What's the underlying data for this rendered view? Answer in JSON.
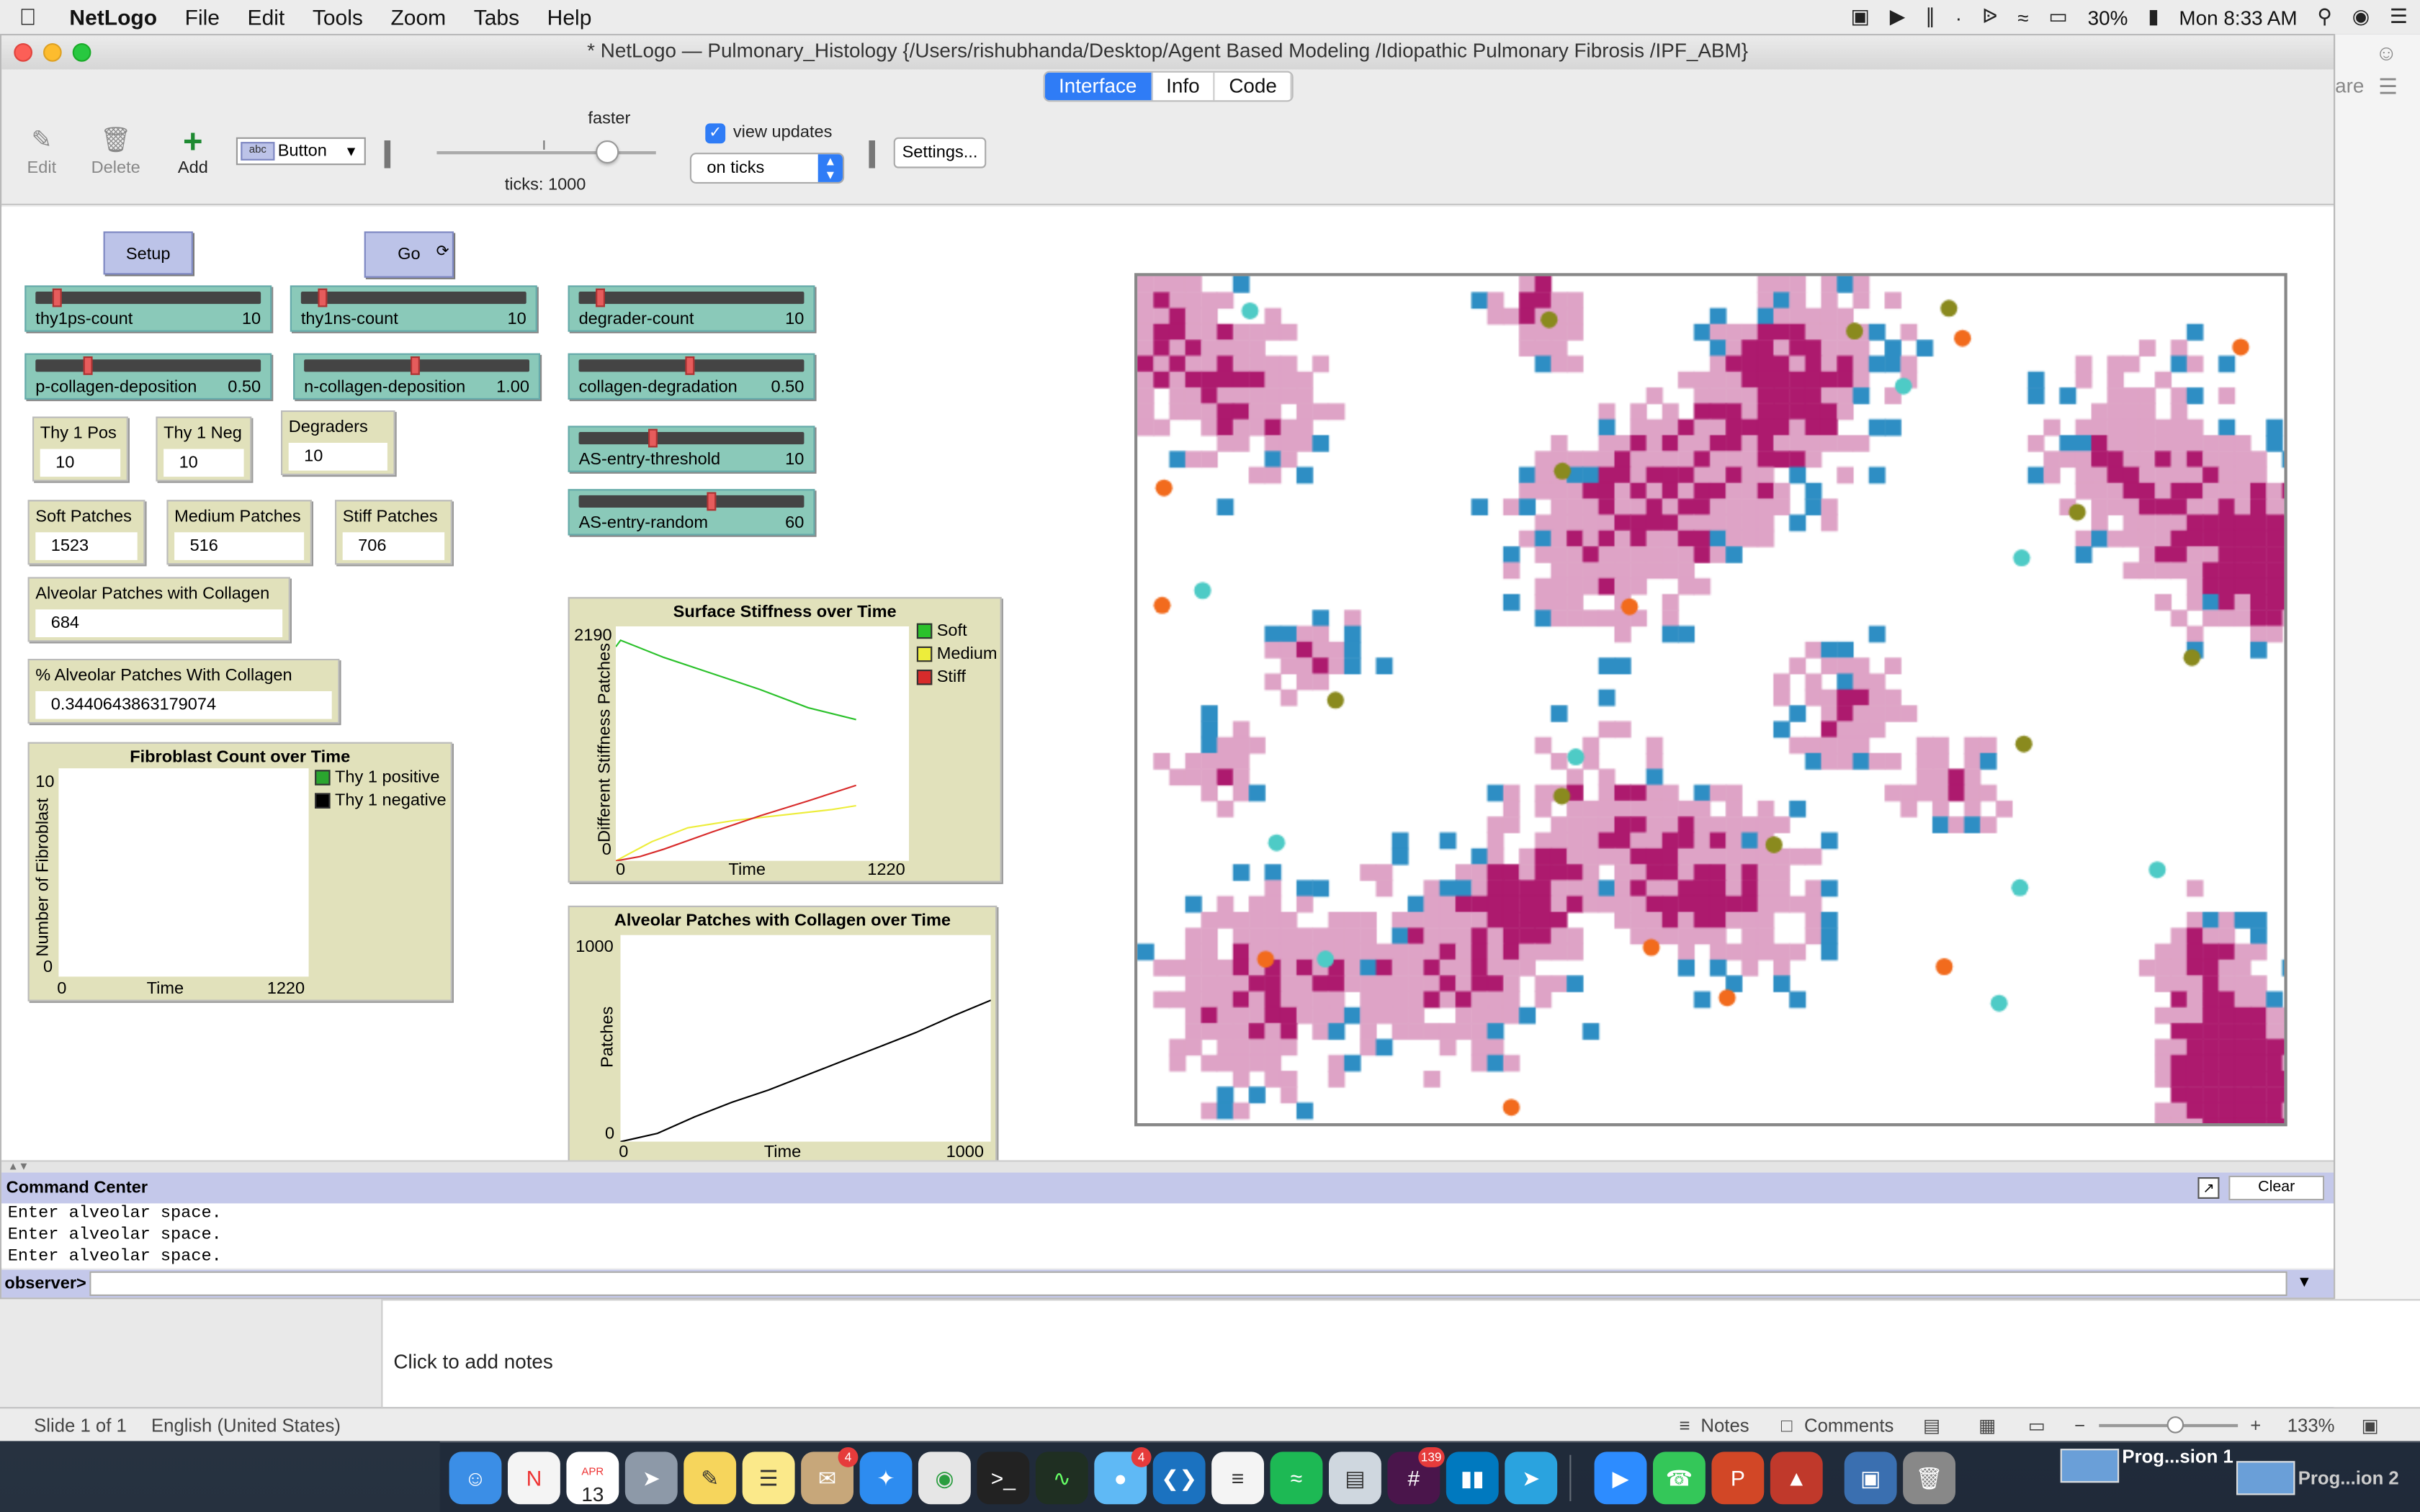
{
  "menubar": {
    "app": "NetLogo",
    "items": [
      "File",
      "Edit",
      "Tools",
      "Zoom",
      "Tabs",
      "Help"
    ],
    "battery": "30%",
    "clock": "Mon 8:33 AM"
  },
  "window": {
    "title": "* NetLogo — Pulmonary_Histology {/Users/rishubhanda/Desktop/Agent Based Modeling /Idiopathic Pulmonary Fibrosis /IPF_ABM}",
    "tabs": [
      "Interface",
      "Info",
      "Code"
    ],
    "active_tab": "Interface"
  },
  "toolbar": {
    "edit": "Edit",
    "delete": "Delete",
    "add": "Add",
    "widget_type": "Button",
    "speed_label": "faster",
    "ticks": "ticks: 1000",
    "view_updates": "view updates",
    "update_mode": "on ticks",
    "settings": "Settings..."
  },
  "buttons": {
    "setup": "Setup",
    "go": "Go"
  },
  "sliders": [
    {
      "label": "thy1ps-count",
      "value": "10",
      "pos": 0.1
    },
    {
      "label": "thy1ns-count",
      "value": "10",
      "pos": 0.1
    },
    {
      "label": "degrader-count",
      "value": "10",
      "pos": 0.1
    },
    {
      "label": "p-collagen-deposition",
      "value": "0.50",
      "pos": 0.2
    },
    {
      "label": "n-collagen-deposition",
      "value": "1.00",
      "pos": 0.5
    },
    {
      "label": "collagen-degradation",
      "value": "0.50",
      "pos": 0.5
    },
    {
      "label": "AS-entry-threshold",
      "value": "10",
      "pos": 0.33
    },
    {
      "label": "AS-entry-random",
      "value": "60",
      "pos": 0.6
    }
  ],
  "monitors": [
    {
      "label": "Thy 1 Pos",
      "value": "10"
    },
    {
      "label": "Thy 1 Neg",
      "value": "10"
    },
    {
      "label": "Degraders",
      "value": "10"
    },
    {
      "label": "Soft Patches",
      "value": "1523"
    },
    {
      "label": "Medium Patches",
      "value": "516"
    },
    {
      "label": "Stiff Patches",
      "value": "706"
    },
    {
      "label": "Alveolar Patches with Collagen",
      "value": "684"
    },
    {
      "label": "% Alveolar Patches With Collagen",
      "value": "0.3440643863179074"
    }
  ],
  "plots": {
    "fibroblast": {
      "title": "Fibroblast Count over Time",
      "ylabel": "Number of Fibroblast",
      "xlabel": "Time",
      "ymax": "10",
      "ymin": "0",
      "xmin": "0",
      "xmax": "1220",
      "legend": [
        {
          "name": "Thy 1 positive",
          "color": "#2aa52e"
        },
        {
          "name": "Thy 1 negative",
          "color": "#000000"
        }
      ]
    },
    "stiffness": {
      "title": "Surface Stiffness over Time",
      "ylabel": "Different Stiffness Patches",
      "xlabel": "Time",
      "ymax": "2190",
      "ymin": "0",
      "xmin": "0",
      "xmax": "1220",
      "legend": [
        {
          "name": "Soft",
          "color": "#2bc12b"
        },
        {
          "name": "Medium",
          "color": "#eded3b"
        },
        {
          "name": "Stiff",
          "color": "#d82b2b"
        }
      ]
    },
    "alveolar": {
      "title": "Alveolar Patches with Collagen over Time",
      "ylabel": "Patches",
      "xlabel": "Time",
      "ymax": "1000",
      "ymin": "0",
      "xmin": "0",
      "xmax": "1000"
    }
  },
  "chart_data": [
    {
      "type": "line",
      "title": "Fibroblast Count over Time",
      "xlabel": "Time",
      "ylabel": "Number of Fibroblast",
      "xlim": [
        0,
        1220
      ],
      "ylim": [
        0,
        10
      ],
      "series": [
        {
          "name": "Thy 1 positive",
          "x": [],
          "y": []
        },
        {
          "name": "Thy 1 negative",
          "x": [],
          "y": []
        }
      ]
    },
    {
      "type": "line",
      "title": "Surface Stiffness over Time",
      "xlabel": "Time",
      "ylabel": "Different Stiffness Patches",
      "xlim": [
        0,
        1220
      ],
      "ylim": [
        0,
        2190
      ],
      "series": [
        {
          "name": "Soft",
          "x": [
            0,
            20,
            200,
            400,
            600,
            800,
            1000
          ],
          "y": [
            2000,
            2060,
            1900,
            1750,
            1600,
            1430,
            1320
          ]
        },
        {
          "name": "Medium",
          "x": [
            0,
            50,
            150,
            300,
            500,
            700,
            900,
            1000
          ],
          "y": [
            0,
            60,
            180,
            310,
            380,
            430,
            480,
            516
          ]
        },
        {
          "name": "Stiff",
          "x": [
            0,
            100,
            200,
            400,
            600,
            800,
            1000
          ],
          "y": [
            0,
            40,
            110,
            270,
            420,
            560,
            706
          ]
        }
      ]
    },
    {
      "type": "line",
      "title": "Alveolar Patches with Collagen over Time",
      "xlabel": "Time",
      "ylabel": "Patches",
      "xlim": [
        0,
        1000
      ],
      "ylim": [
        0,
        1000
      ],
      "series": [
        {
          "name": "",
          "x": [
            0,
            50,
            100,
            200,
            300,
            400,
            500,
            600,
            700,
            800,
            900,
            1000
          ],
          "y": [
            0,
            20,
            40,
            120,
            190,
            250,
            320,
            390,
            460,
            530,
            610,
            684
          ]
        }
      ]
    }
  ],
  "view_colors": {
    "soft": "#ffffff",
    "medium": "#dea3c6",
    "stiff": "#ad1a6e",
    "collagen": "#2e8ec4"
  },
  "turtle_colors": {
    "thy1pos": "#8a8a1e",
    "thy1neg": "#f26b1d",
    "degrader": "#4ecbc6"
  },
  "command_center": {
    "title": "Command Center",
    "clear": "Clear",
    "output": [
      "Enter alveolar space.",
      "Enter alveolar space.",
      "Enter alveolar space."
    ],
    "prompt": "observer>",
    "input": ""
  },
  "keynote": {
    "notes_placeholder": "Click to add notes",
    "slide": "Slide 1 of 1",
    "language": "English (United States)",
    "notes": "Notes",
    "comments": "Comments",
    "zoom": "133%",
    "share": "are"
  },
  "dock": {
    "calendar_month": "APR",
    "calendar_day": "13",
    "mail_badge": "4",
    "messages_badge": "4",
    "slack_badge": "139",
    "stack1": "Prog...sion 1",
    "stack2": "Prog...ion 2"
  }
}
